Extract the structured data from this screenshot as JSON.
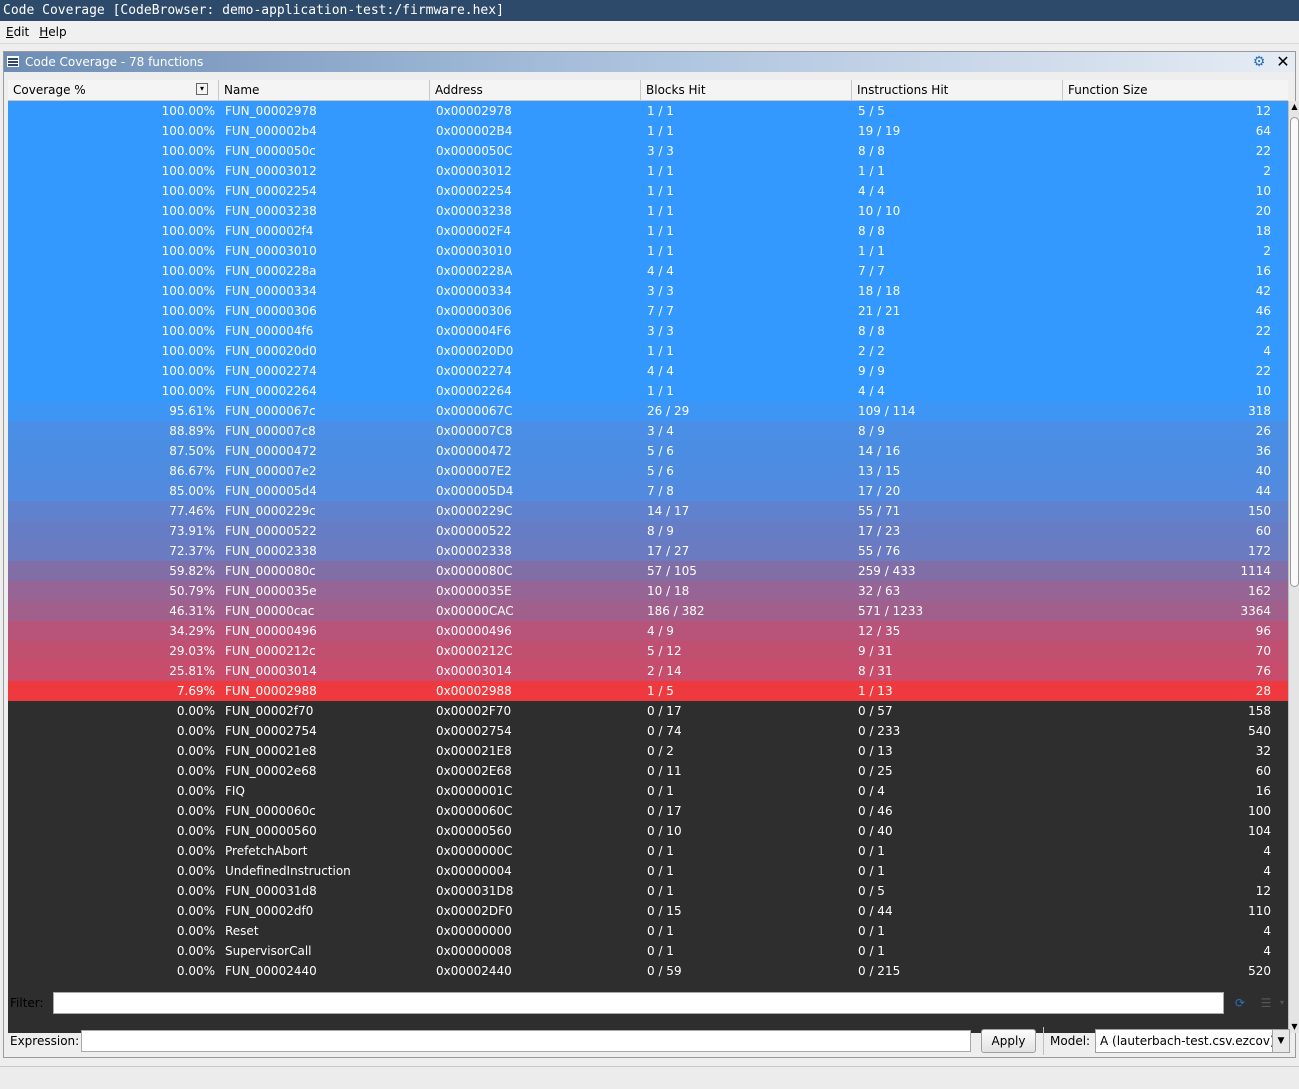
{
  "window": {
    "title": "Code Coverage [CodeBrowser: demo-application-test:/firmware.hex]"
  },
  "menu": {
    "items": [
      {
        "mnemonic": "E",
        "rest": "dit"
      },
      {
        "mnemonic": "H",
        "rest": "elp"
      }
    ]
  },
  "panel": {
    "title": "Code Coverage - 78 functions",
    "settings_icon": "gear-icon",
    "close_icon": "close-icon"
  },
  "table": {
    "columns": [
      "Coverage %",
      "Name",
      "Address",
      "Blocks Hit",
      "Instructions Hit",
      "Function Size"
    ],
    "rows": [
      {
        "coverage": "100.00%",
        "name": "FUN_00002978",
        "address": "0x00002978",
        "blocks": "1 / 1",
        "instructions": "5 / 5",
        "size": "12",
        "color": "#3399ff"
      },
      {
        "coverage": "100.00%",
        "name": "FUN_000002b4",
        "address": "0x000002B4",
        "blocks": "1 / 1",
        "instructions": "19 / 19",
        "size": "64",
        "color": "#3399ff"
      },
      {
        "coverage": "100.00%",
        "name": "FUN_0000050c",
        "address": "0x0000050C",
        "blocks": "3 / 3",
        "instructions": "8 / 8",
        "size": "22",
        "color": "#3399ff"
      },
      {
        "coverage": "100.00%",
        "name": "FUN_00003012",
        "address": "0x00003012",
        "blocks": "1 / 1",
        "instructions": "1 / 1",
        "size": "2",
        "color": "#3399ff"
      },
      {
        "coverage": "100.00%",
        "name": "FUN_00002254",
        "address": "0x00002254",
        "blocks": "1 / 1",
        "instructions": "4 / 4",
        "size": "10",
        "color": "#3399ff"
      },
      {
        "coverage": "100.00%",
        "name": "FUN_00003238",
        "address": "0x00003238",
        "blocks": "1 / 1",
        "instructions": "10 / 10",
        "size": "20",
        "color": "#3399ff"
      },
      {
        "coverage": "100.00%",
        "name": "FUN_000002f4",
        "address": "0x000002F4",
        "blocks": "1 / 1",
        "instructions": "8 / 8",
        "size": "18",
        "color": "#3399ff"
      },
      {
        "coverage": "100.00%",
        "name": "FUN_00003010",
        "address": "0x00003010",
        "blocks": "1 / 1",
        "instructions": "1 / 1",
        "size": "2",
        "color": "#3399ff"
      },
      {
        "coverage": "100.00%",
        "name": "FUN_0000228a",
        "address": "0x0000228A",
        "blocks": "4 / 4",
        "instructions": "7 / 7",
        "size": "16",
        "color": "#3399ff"
      },
      {
        "coverage": "100.00%",
        "name": "FUN_00000334",
        "address": "0x00000334",
        "blocks": "3 / 3",
        "instructions": "18 / 18",
        "size": "42",
        "color": "#3399ff"
      },
      {
        "coverage": "100.00%",
        "name": "FUN_00000306",
        "address": "0x00000306",
        "blocks": "7 / 7",
        "instructions": "21 / 21",
        "size": "46",
        "color": "#3399ff"
      },
      {
        "coverage": "100.00%",
        "name": "FUN_000004f6",
        "address": "0x000004F6",
        "blocks": "3 / 3",
        "instructions": "8 / 8",
        "size": "22",
        "color": "#3399ff"
      },
      {
        "coverage": "100.00%",
        "name": "FUN_000020d0",
        "address": "0x000020D0",
        "blocks": "1 / 1",
        "instructions": "2 / 2",
        "size": "4",
        "color": "#3399ff"
      },
      {
        "coverage": "100.00%",
        "name": "FUN_00002274",
        "address": "0x00002274",
        "blocks": "4 / 4",
        "instructions": "9 / 9",
        "size": "22",
        "color": "#3399ff"
      },
      {
        "coverage": "100.00%",
        "name": "FUN_00002264",
        "address": "0x00002264",
        "blocks": "1 / 1",
        "instructions": "4 / 4",
        "size": "10",
        "color": "#3399ff"
      },
      {
        "coverage": "95.61%",
        "name": "FUN_0000067c",
        "address": "0x0000067C",
        "blocks": "26 / 29",
        "instructions": "109 / 114",
        "size": "318",
        "color": "#3d96f5"
      },
      {
        "coverage": "88.89%",
        "name": "FUN_000007c8",
        "address": "0x000007C8",
        "blocks": "3 / 4",
        "instructions": "8 / 9",
        "size": "26",
        "color": "#4a8ee6"
      },
      {
        "coverage": "87.50%",
        "name": "FUN_00000472",
        "address": "0x00000472",
        "blocks": "5 / 6",
        "instructions": "14 / 16",
        "size": "36",
        "color": "#4c8de4"
      },
      {
        "coverage": "86.67%",
        "name": "FUN_000007e2",
        "address": "0x000007E2",
        "blocks": "5 / 6",
        "instructions": "13 / 15",
        "size": "40",
        "color": "#4e8ce2"
      },
      {
        "coverage": "85.00%",
        "name": "FUN_000005d4",
        "address": "0x000005D4",
        "blocks": "7 / 8",
        "instructions": "17 / 20",
        "size": "44",
        "color": "#518ade"
      },
      {
        "coverage": "77.46%",
        "name": "FUN_0000229c",
        "address": "0x0000229C",
        "blocks": "14 / 17",
        "instructions": "55 / 71",
        "size": "150",
        "color": "#6081cd"
      },
      {
        "coverage": "73.91%",
        "name": "FUN_00000522",
        "address": "0x00000522",
        "blocks": "8 / 9",
        "instructions": "17 / 23",
        "size": "60",
        "color": "#667dc6"
      },
      {
        "coverage": "72.37%",
        "name": "FUN_00002338",
        "address": "0x00002338",
        "blocks": "17 / 27",
        "instructions": "55 / 76",
        "size": "172",
        "color": "#6a7bc2"
      },
      {
        "coverage": "59.82%",
        "name": "FUN_0000080c",
        "address": "0x0000080C",
        "blocks": "57 / 105",
        "instructions": "259 / 433",
        "size": "1114",
        "color": "#826ea6"
      },
      {
        "coverage": "50.79%",
        "name": "FUN_0000035e",
        "address": "0x0000035E",
        "blocks": "10 / 18",
        "instructions": "32 / 63",
        "size": "162",
        "color": "#966495"
      },
      {
        "coverage": "46.31%",
        "name": "FUN_00000cac",
        "address": "0x00000CAC",
        "blocks": "186 / 382",
        "instructions": "571 / 1233",
        "size": "3364",
        "color": "#a0608b"
      },
      {
        "coverage": "34.29%",
        "name": "FUN_00000496",
        "address": "0x00000496",
        "blocks": "4 / 9",
        "instructions": "12 / 35",
        "size": "96",
        "color": "#b8537a"
      },
      {
        "coverage": "29.03%",
        "name": "FUN_0000212c",
        "address": "0x0000212C",
        "blocks": "5 / 12",
        "instructions": "9 / 31",
        "size": "70",
        "color": "#c14f70"
      },
      {
        "coverage": "25.81%",
        "name": "FUN_00003014",
        "address": "0x00003014",
        "blocks": "2 / 14",
        "instructions": "8 / 31",
        "size": "76",
        "color": "#c84c6b"
      },
      {
        "coverage": "7.69%",
        "name": "FUN_00002988",
        "address": "0x00002988",
        "blocks": "1 / 5",
        "instructions": "1 / 13",
        "size": "28",
        "color": "#ee3a3e"
      },
      {
        "coverage": "0.00%",
        "name": "FUN_00002f70",
        "address": "0x00002F70",
        "blocks": "0 / 17",
        "instructions": "0 / 57",
        "size": "158",
        "color": "#2e2e2e"
      },
      {
        "coverage": "0.00%",
        "name": "FUN_00002754",
        "address": "0x00002754",
        "blocks": "0 / 74",
        "instructions": "0 / 233",
        "size": "540",
        "color": "#2e2e2e"
      },
      {
        "coverage": "0.00%",
        "name": "FUN_000021e8",
        "address": "0x000021E8",
        "blocks": "0 / 2",
        "instructions": "0 / 13",
        "size": "32",
        "color": "#2e2e2e"
      },
      {
        "coverage": "0.00%",
        "name": "FUN_00002e68",
        "address": "0x00002E68",
        "blocks": "0 / 11",
        "instructions": "0 / 25",
        "size": "60",
        "color": "#2e2e2e"
      },
      {
        "coverage": "0.00%",
        "name": "FIQ",
        "address": "0x0000001C",
        "blocks": "0 / 1",
        "instructions": "0 / 4",
        "size": "16",
        "color": "#2e2e2e"
      },
      {
        "coverage": "0.00%",
        "name": "FUN_0000060c",
        "address": "0x0000060C",
        "blocks": "0 / 17",
        "instructions": "0 / 46",
        "size": "100",
        "color": "#2e2e2e"
      },
      {
        "coverage": "0.00%",
        "name": "FUN_00000560",
        "address": "0x00000560",
        "blocks": "0 / 10",
        "instructions": "0 / 40",
        "size": "104",
        "color": "#2e2e2e"
      },
      {
        "coverage": "0.00%",
        "name": "PrefetchAbort",
        "address": "0x0000000C",
        "blocks": "0 / 1",
        "instructions": "0 / 1",
        "size": "4",
        "color": "#2e2e2e"
      },
      {
        "coverage": "0.00%",
        "name": "UndefinedInstruction",
        "address": "0x00000004",
        "blocks": "0 / 1",
        "instructions": "0 / 1",
        "size": "4",
        "color": "#2e2e2e"
      },
      {
        "coverage": "0.00%",
        "name": "FUN_000031d8",
        "address": "0x000031D8",
        "blocks": "0 / 1",
        "instructions": "0 / 5",
        "size": "12",
        "color": "#2e2e2e"
      },
      {
        "coverage": "0.00%",
        "name": "FUN_00002df0",
        "address": "0x00002DF0",
        "blocks": "0 / 15",
        "instructions": "0 / 44",
        "size": "110",
        "color": "#2e2e2e"
      },
      {
        "coverage": "0.00%",
        "name": "Reset",
        "address": "0x00000000",
        "blocks": "0 / 1",
        "instructions": "0 / 1",
        "size": "4",
        "color": "#2e2e2e"
      },
      {
        "coverage": "0.00%",
        "name": "SupervisorCall",
        "address": "0x00000008",
        "blocks": "0 / 1",
        "instructions": "0 / 1",
        "size": "4",
        "color": "#2e2e2e"
      },
      {
        "coverage": "0.00%",
        "name": "FUN_00002440",
        "address": "0x00002440",
        "blocks": "0 / 59",
        "instructions": "0 / 215",
        "size": "520",
        "color": "#2e2e2e"
      }
    ]
  },
  "filter": {
    "label": "Filter:",
    "value": ""
  },
  "expression": {
    "label": "Expression:",
    "value": "",
    "apply_label": "Apply"
  },
  "model": {
    "label": "Model:",
    "selected": "A (lauterbach-test.csv.ezcov)"
  }
}
